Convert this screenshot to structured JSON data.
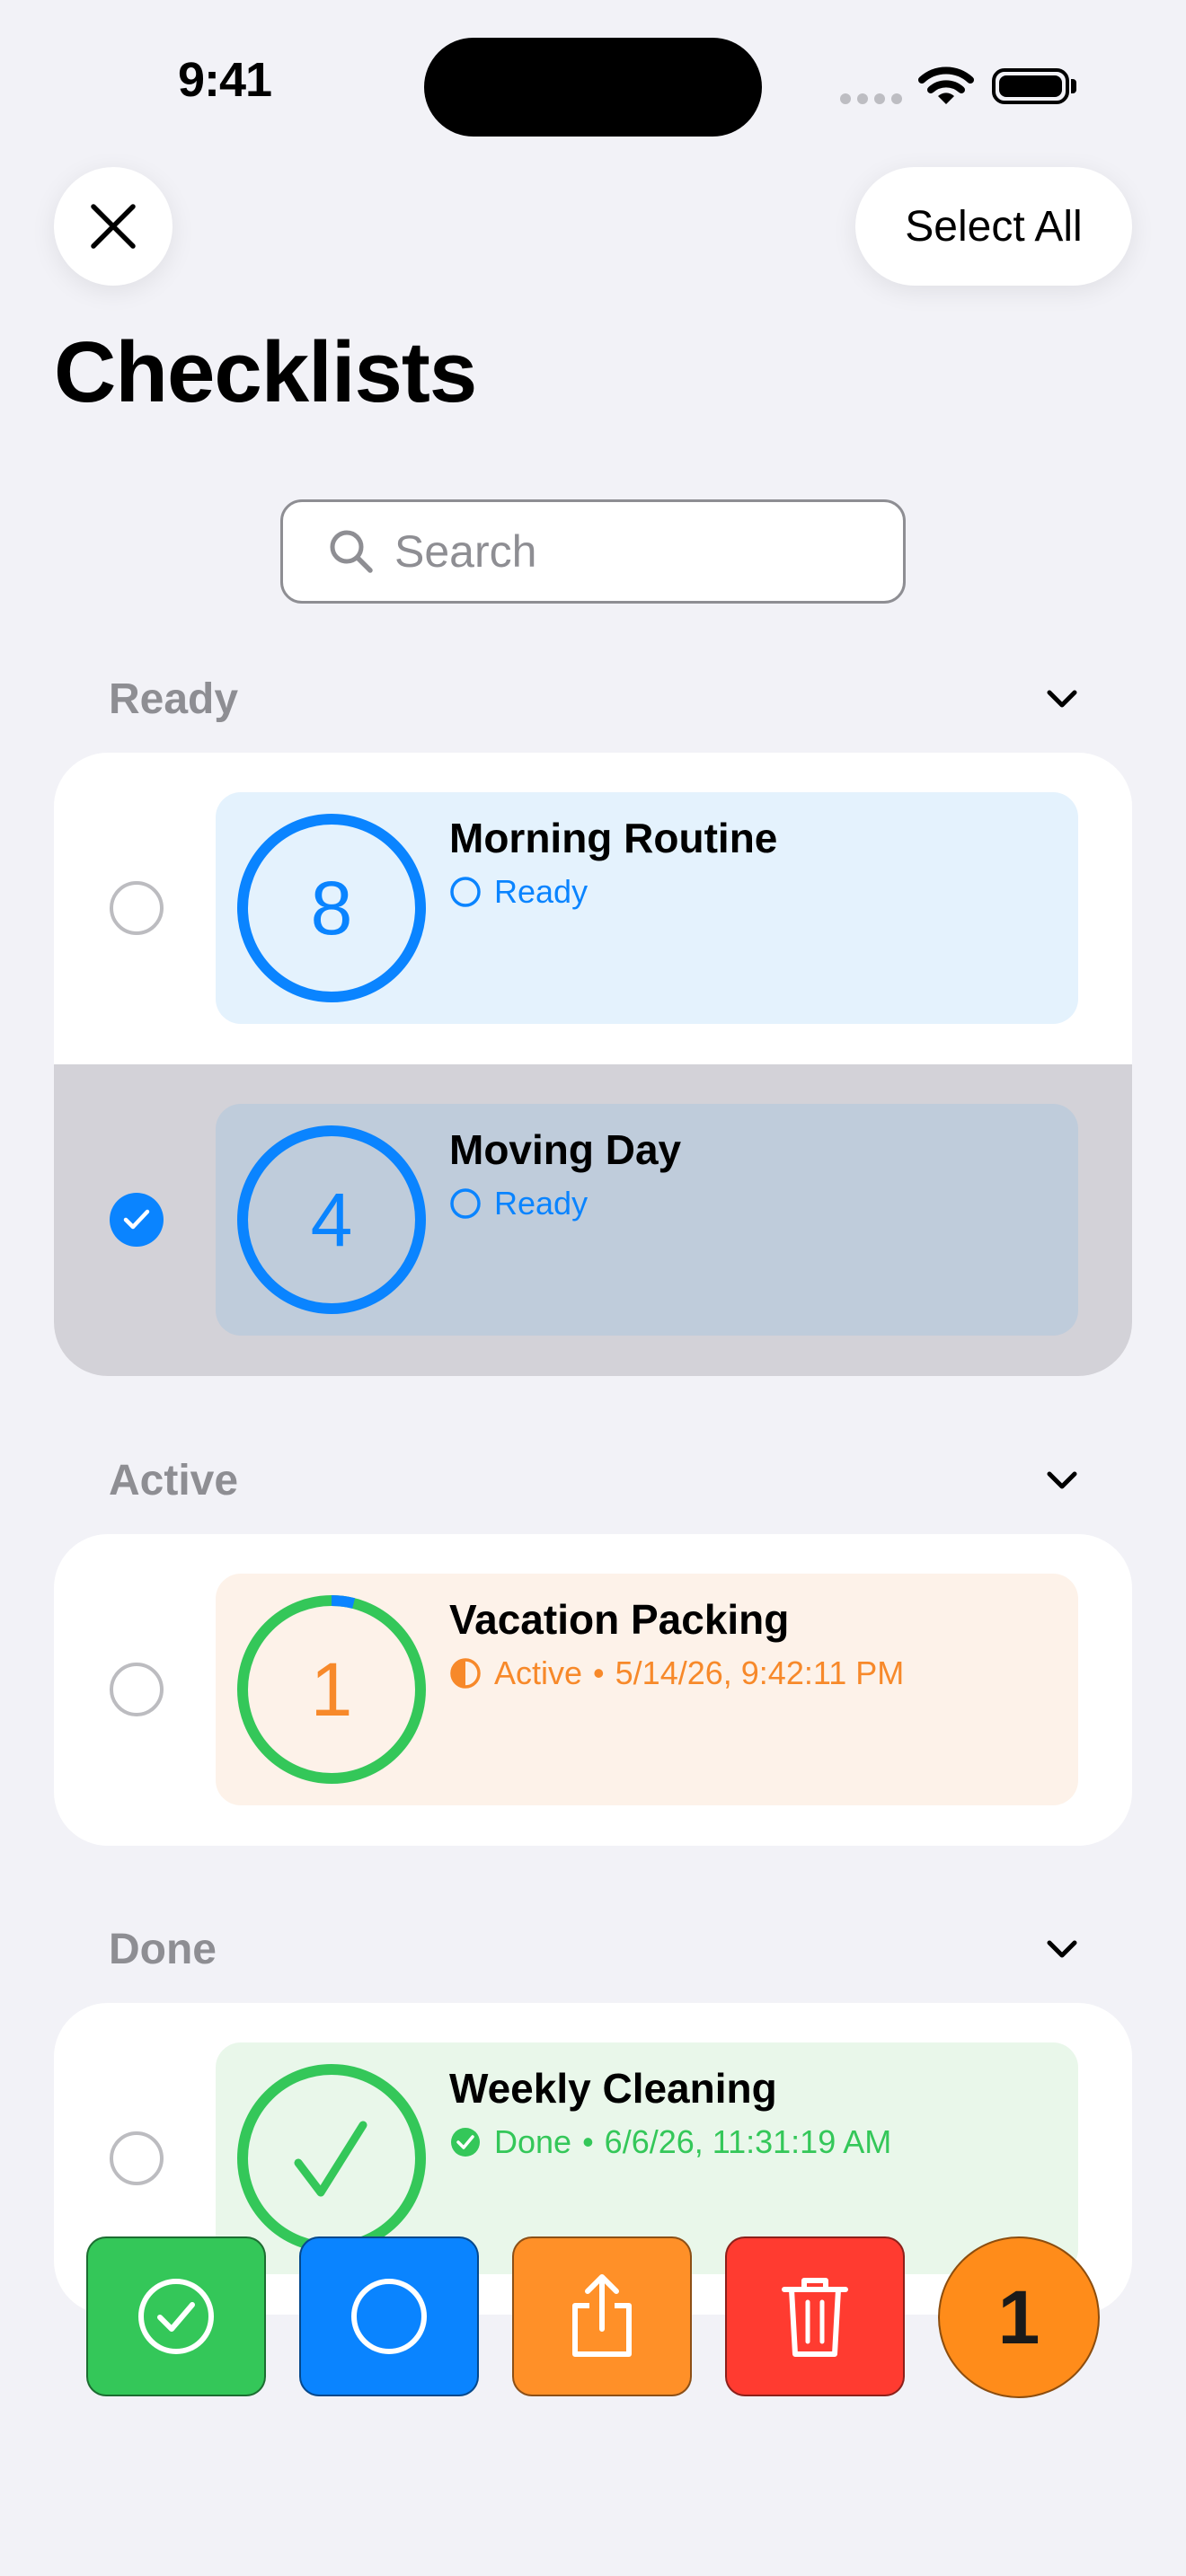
{
  "status_bar": {
    "time": "9:41"
  },
  "nav": {
    "select_all_label": "Select All"
  },
  "page": {
    "title": "Checklists"
  },
  "search": {
    "placeholder": "Search"
  },
  "sections": [
    {
      "title": "Ready",
      "items": [
        {
          "title": "Morning Routine",
          "count": "8",
          "status": "Ready",
          "timestamp": "",
          "selected": false
        },
        {
          "title": "Moving Day",
          "count": "4",
          "status": "Ready",
          "timestamp": "",
          "selected": true
        }
      ]
    },
    {
      "title": "Active",
      "items": [
        {
          "title": "Vacation Packing",
          "count": "1",
          "status": "Active",
          "timestamp": "5/14/26, 9:42:11 PM",
          "selected": false,
          "progress": 0.04
        }
      ]
    },
    {
      "title": "Done",
      "items": [
        {
          "title": "Weekly Cleaning",
          "count": "",
          "status": "Done",
          "timestamp": "6/6/26, 11:31:19 AM",
          "selected": false
        }
      ]
    }
  ],
  "actions": {
    "complete_icon": "checkmark-circle-icon",
    "reset_icon": "circle-icon",
    "share_icon": "share-icon",
    "delete_icon": "trash-icon",
    "selected_count": "1"
  },
  "colors": {
    "accent_blue": "#0A84FF",
    "ready_tile": "#E4F2FD",
    "ready_tile_selected": "#BFCCDB",
    "active_tile": "#FDF2E9",
    "active_orange": "#F7892A",
    "done_tile": "#E9F7EA",
    "done_green": "#34C759",
    "delete_red": "#FF3B30"
  }
}
